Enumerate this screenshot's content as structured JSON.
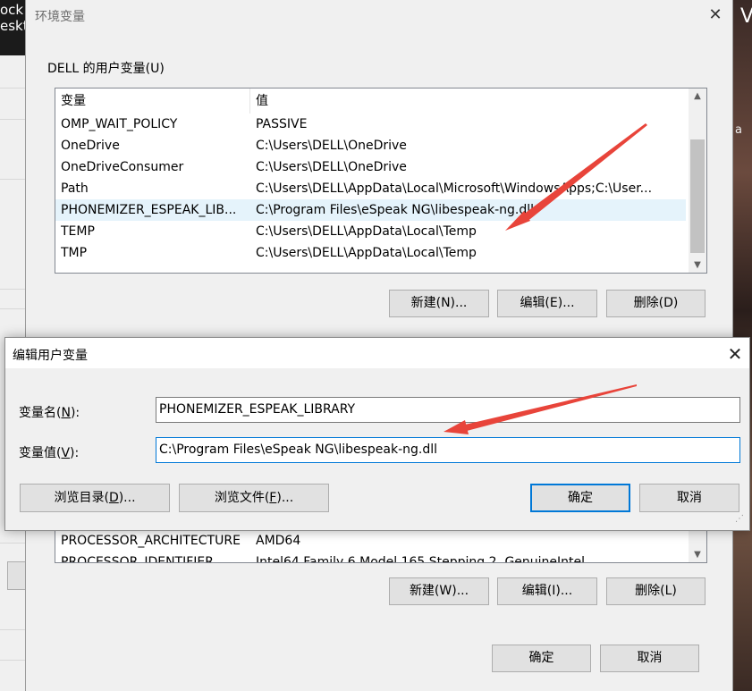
{
  "desktop": {
    "left_text": "ock\neskt",
    "right_text": "a",
    "right_top_text": "V"
  },
  "env_window": {
    "title": "环境变量",
    "close_glyph": "✕",
    "user_group_label": "DELL 的用户变量(U)",
    "columns": [
      "变量",
      "值"
    ],
    "rows": [
      {
        "name": "OMP_WAIT_POLICY",
        "value": "PASSIVE"
      },
      {
        "name": "OneDrive",
        "value": "C:\\Users\\DELL\\OneDrive"
      },
      {
        "name": "OneDriveConsumer",
        "value": "C:\\Users\\DELL\\OneDrive"
      },
      {
        "name": "Path",
        "value": "C:\\Users\\DELL\\AppData\\Local\\Microsoft\\WindowsApps;C:\\User..."
      },
      {
        "name": "PHONEMIZER_ESPEAK_LIB...",
        "value": "C:\\Program Files\\eSpeak NG\\libespeak-ng.dll"
      },
      {
        "name": "TEMP",
        "value": "C:\\Users\\DELL\\AppData\\Local\\Temp"
      },
      {
        "name": "TMP",
        "value": "C:\\Users\\DELL\\AppData\\Local\\Temp"
      }
    ],
    "user_buttons": {
      "new": "新建(N)...",
      "edit": "编辑(E)...",
      "delete": "删除(D)"
    },
    "sys_rows": [
      {
        "name": "PROCESSOR_ARCHITECTURE",
        "value": "AMD64"
      },
      {
        "name": "PROCESSOR_IDENTIFIER",
        "value": "Intel64 Family 6 Model 165 Stepping 2, GenuineIntel"
      }
    ],
    "sys_buttons": {
      "new": "新建(W)...",
      "edit": "编辑(I)...",
      "delete": "删除(L)"
    },
    "ok": "确定",
    "cancel": "取消"
  },
  "edit_dialog": {
    "title": "编辑用户变量",
    "close_glyph": "✕",
    "name_label_pre": "变量名(",
    "name_label_key": "N",
    "name_label_post": "):",
    "value_label_pre": "变量值(",
    "value_label_key": "V",
    "value_label_post": "):",
    "name_value": "PHONEMIZER_ESPEAK_LIBRARY",
    "value_value": "C:\\Program Files\\eSpeak NG\\libespeak-ng.dll",
    "browse_dir_pre": "浏览目录(",
    "browse_dir_key": "D",
    "browse_dir_post": ")...",
    "browse_file_pre": "浏览文件(",
    "browse_file_key": "F",
    "browse_file_post": ")...",
    "ok": "确定",
    "cancel": "取消"
  },
  "colors": {
    "accent": "#0078d7",
    "arrow": "#e8443a",
    "selection": "#e5f3fb"
  }
}
